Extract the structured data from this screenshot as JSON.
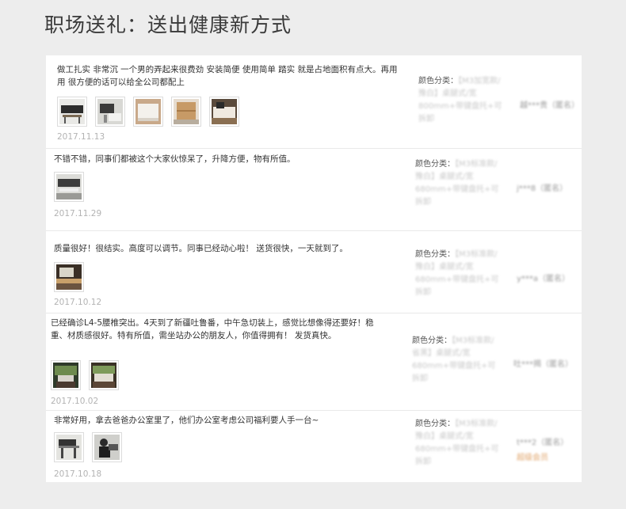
{
  "page": {
    "title": "职场送礼：送出健康新方式"
  },
  "reviews": [
    {
      "text": "做工扎实 非常沉 一个男的弄起来很费劲 安装简便 使用简单 踏实 就是占地面积有点大。再用用 很方便的话可以给全公司都配上",
      "date": "2017.11.13",
      "sku_label": "颜色分类：",
      "sku_value": "【M3加宽款/豫白】桌腿式/宽800mm+带键盘托+可拆卸",
      "reviewer": "越***贵（匿名）",
      "badge": ""
    },
    {
      "text": "不错不错，同事们都被这个大家伙惊呆了，升降方便，物有所值。",
      "date": "2017.11.29",
      "sku_label": "颜色分类：",
      "sku_value": "【M3标准款/豫白】桌腿式/宽680mm+带键盘托+可拆卸",
      "reviewer": "j***8（匿名）",
      "badge": ""
    },
    {
      "text": "质量很好！很结实。高度可以调节。同事已经动心啦！ 送货很快，一天就到了。",
      "date": "2017.10.12",
      "sku_label": "颜色分类：",
      "sku_value": "【M3标准款/豫白】桌腿式/宽680mm+带键盘托+可拆卸",
      "reviewer": "y***a（匿名）",
      "badge": ""
    },
    {
      "text": "已经确诊L4-5腰椎突出。4天到了新疆吐鲁番，中午急切装上，感觉比想像得还要好！稳重、材质感很好。特有所值，需坐站办公的朋友人，你值得拥有！ 发货真快。",
      "date": "2017.10.02",
      "sku_label": "颜色分类：",
      "sku_value": "【M3标准款/省黑】桌腿式/宽680mm+带键盘托+可拆卸",
      "reviewer": "吐***揭（匿名）",
      "badge": ""
    },
    {
      "text": "非常好用，拿去爸爸办公室里了，他们办公室考虑公司福利要人手一台~",
      "date": "2017.10.18",
      "sku_label": "颜色分类：",
      "sku_value": "【M3标准款/豫白】桌腿式/宽680mm+带键盘托+可拆卸",
      "reviewer": "t***2（匿名）",
      "badge": "超级会员"
    }
  ],
  "colors": {
    "background": "#ededed",
    "card": "#ffffff",
    "date": "#b3b3b3",
    "badge": "#e0a46a"
  }
}
